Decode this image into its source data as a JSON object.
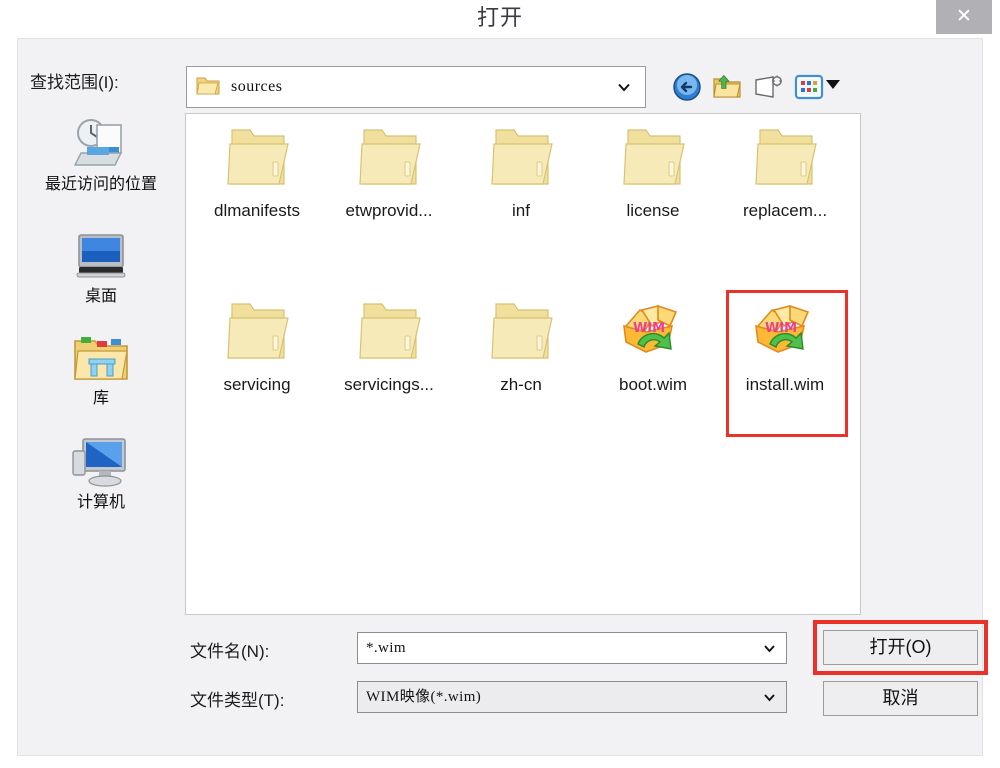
{
  "window": {
    "title": "打开",
    "close_label": "✕",
    "close_icon": "close-icon"
  },
  "lookin": {
    "label": "查找范围(I):",
    "value": "sources",
    "icon": "folder-icon",
    "dropdown_icon": "chevron-down-icon"
  },
  "toolbar": {
    "items": [
      {
        "name": "back-button",
        "icon": "back-arrow-icon",
        "tooltip": "后退"
      },
      {
        "name": "up-one-level-button",
        "icon": "up-folder-icon",
        "tooltip": "向上一级"
      },
      {
        "name": "new-folder-button",
        "icon": "new-folder-icon",
        "tooltip": "新建文件夹"
      },
      {
        "name": "views-button",
        "icon": "views-icon",
        "tooltip": "视图"
      }
    ],
    "views_caret_icon": "caret-down-icon"
  },
  "places": {
    "items": [
      {
        "label": "最近访问的位置",
        "icon": "recent-places-icon"
      },
      {
        "label": "桌面",
        "icon": "desktop-icon"
      },
      {
        "label": "库",
        "icon": "libraries-icon"
      },
      {
        "label": "计算机",
        "icon": "computer-icon"
      }
    ]
  },
  "filelist": {
    "items": [
      {
        "label": "dlmanifests",
        "type": "folder",
        "selected": false
      },
      {
        "label": "etwprovid...",
        "type": "folder",
        "selected": false
      },
      {
        "label": "inf",
        "type": "folder",
        "selected": false
      },
      {
        "label": "license",
        "type": "folder",
        "selected": false
      },
      {
        "label": "replacem...",
        "type": "folder",
        "selected": false
      },
      {
        "label": "servicing",
        "type": "folder",
        "selected": false
      },
      {
        "label": "servicings...",
        "type": "folder",
        "selected": false
      },
      {
        "label": "zh-cn",
        "type": "folder",
        "selected": false
      },
      {
        "label": "boot.wim",
        "type": "wim",
        "selected": false
      },
      {
        "label": "install.wim",
        "type": "wim",
        "selected": true
      }
    ]
  },
  "form": {
    "filename_label": "文件名(N):",
    "filename_value": "*.wim",
    "filetype_label": "文件类型(T):",
    "filetype_value": "WIM映像(*.wim)",
    "dropdown_icon": "chevron-down-icon"
  },
  "actions": {
    "open_label": "打开(O)",
    "cancel_label": "取消"
  },
  "highlights": {
    "accent_color": "#e8322a",
    "selected_file": "install.wim",
    "highlighted_button": "打开(O)"
  },
  "colors": {
    "dialog_background": "#f2f1f3",
    "list_background": "#ffffff",
    "titlebar_background": "#ffffff",
    "close_button_background": "#b0b0b5",
    "folder_yellow": "#f4e3a0",
    "wim_orange": "#f9b233",
    "wim_green": "#3fae3a",
    "wim_pink": "#ec3f8f"
  }
}
